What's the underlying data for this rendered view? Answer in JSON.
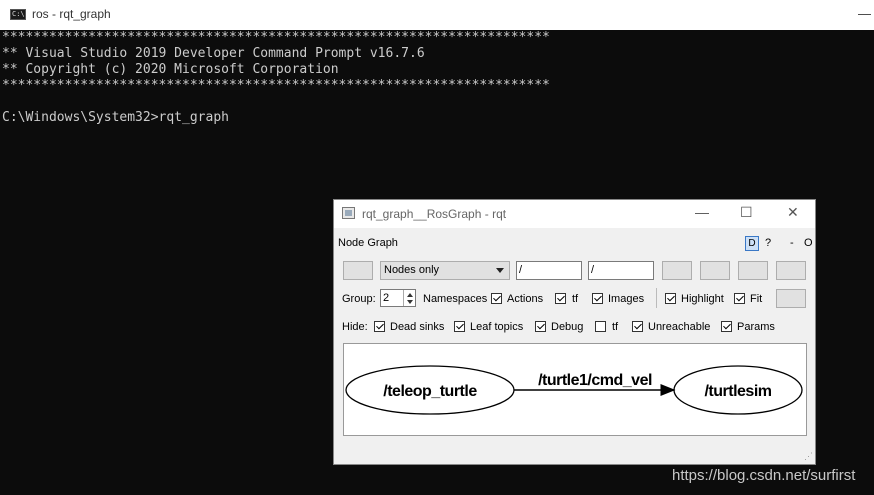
{
  "console": {
    "title": "ros - rqt_graph",
    "min_glyph": "—",
    "lines": [
      "**********************************************************************",
      "** Visual Studio 2019 Developer Command Prompt v16.7.6",
      "** Copyright (c) 2020 Microsoft Corporation",
      "**********************************************************************",
      "",
      "C:\\Windows\\System32>rqt_graph"
    ]
  },
  "rqt": {
    "title": "rqt_graph__RosGraph - rqt",
    "controls": {
      "minimize": "—",
      "maximize": "☐",
      "close": "✕"
    },
    "plugin_label": "Node Graph",
    "dock": {
      "d": "D",
      "help": "?",
      "minus": "-",
      "o": "O"
    },
    "toolbar": {
      "mode": "Nodes only",
      "node_filter": "/",
      "topic_filter": "/"
    },
    "options": {
      "group_label": "Group:",
      "group_value": "2",
      "namespaces": "Namespaces",
      "actions": "Actions",
      "tf": "tf",
      "images": "Images",
      "highlight": "Highlight",
      "fit": "Fit"
    },
    "hide": {
      "label": "Hide:",
      "dead_sinks": "Dead sinks",
      "leaf_topics": "Leaf topics",
      "debug": "Debug",
      "tf": "tf",
      "unreachable": "Unreachable",
      "params": "Params"
    },
    "graph": {
      "nodes": [
        "/teleop_turtle",
        "/turtlesim"
      ],
      "edge_label": "/turtle1/cmd_vel"
    }
  },
  "watermark": "https://blog.csdn.net/surfirst"
}
